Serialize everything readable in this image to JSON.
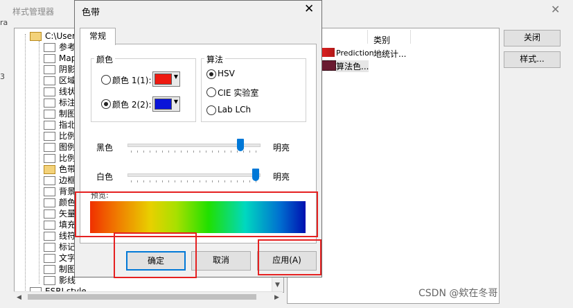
{
  "background_window": {
    "title": "样式管理器",
    "close_symbol": "✕",
    "edge_text_a": "ra",
    "edge_text_b": "3",
    "tree": {
      "root": "C:\\Users\\",
      "items": [
        "参考",
        "Maple",
        "阴影",
        "区域",
        "线状",
        "标注",
        "制图",
        "指北",
        "比例",
        "图例",
        "比例",
        "色带",
        "边框",
        "背景",
        "颜色",
        "矢量",
        "填充",
        "线符",
        "标记",
        "文字",
        "制图",
        "影线"
      ],
      "selected": "色带",
      "bottom_item": "ESRI.style"
    },
    "list": {
      "header_category": "类别",
      "rows": [
        {
          "name": "Prediction",
          "category": "地统计..."
        },
        {
          "name": "算法色...",
          "category": ""
        }
      ]
    },
    "buttons": {
      "close": "关闭",
      "style": "样式..."
    }
  },
  "dialog": {
    "title": "色带",
    "close_symbol": "✕",
    "tab": "常规",
    "color_group": {
      "title": "颜色",
      "color1_label": "颜色 1(1):",
      "color2_label": "颜色 2(2):",
      "selected": "color2",
      "color1_value": "#ee1a10",
      "color2_value": "#0a14d8"
    },
    "algo_group": {
      "title": "算法",
      "options": [
        "HSV",
        "CIE 实验室",
        "Lab LCh"
      ],
      "selected": "HSV"
    },
    "sliders": {
      "black_label": "黑色",
      "white_label": "白色",
      "bright_label": "明亮",
      "black_level": 0.88,
      "white_level": 1.0
    },
    "preview_label": "预览:",
    "buttons": {
      "ok": "确定",
      "cancel": "取消",
      "apply": "应用(A)"
    }
  },
  "watermark": "CSDN @欸在冬哥",
  "colors": {
    "highlight": "#e52020",
    "accent": "#0078d7"
  }
}
